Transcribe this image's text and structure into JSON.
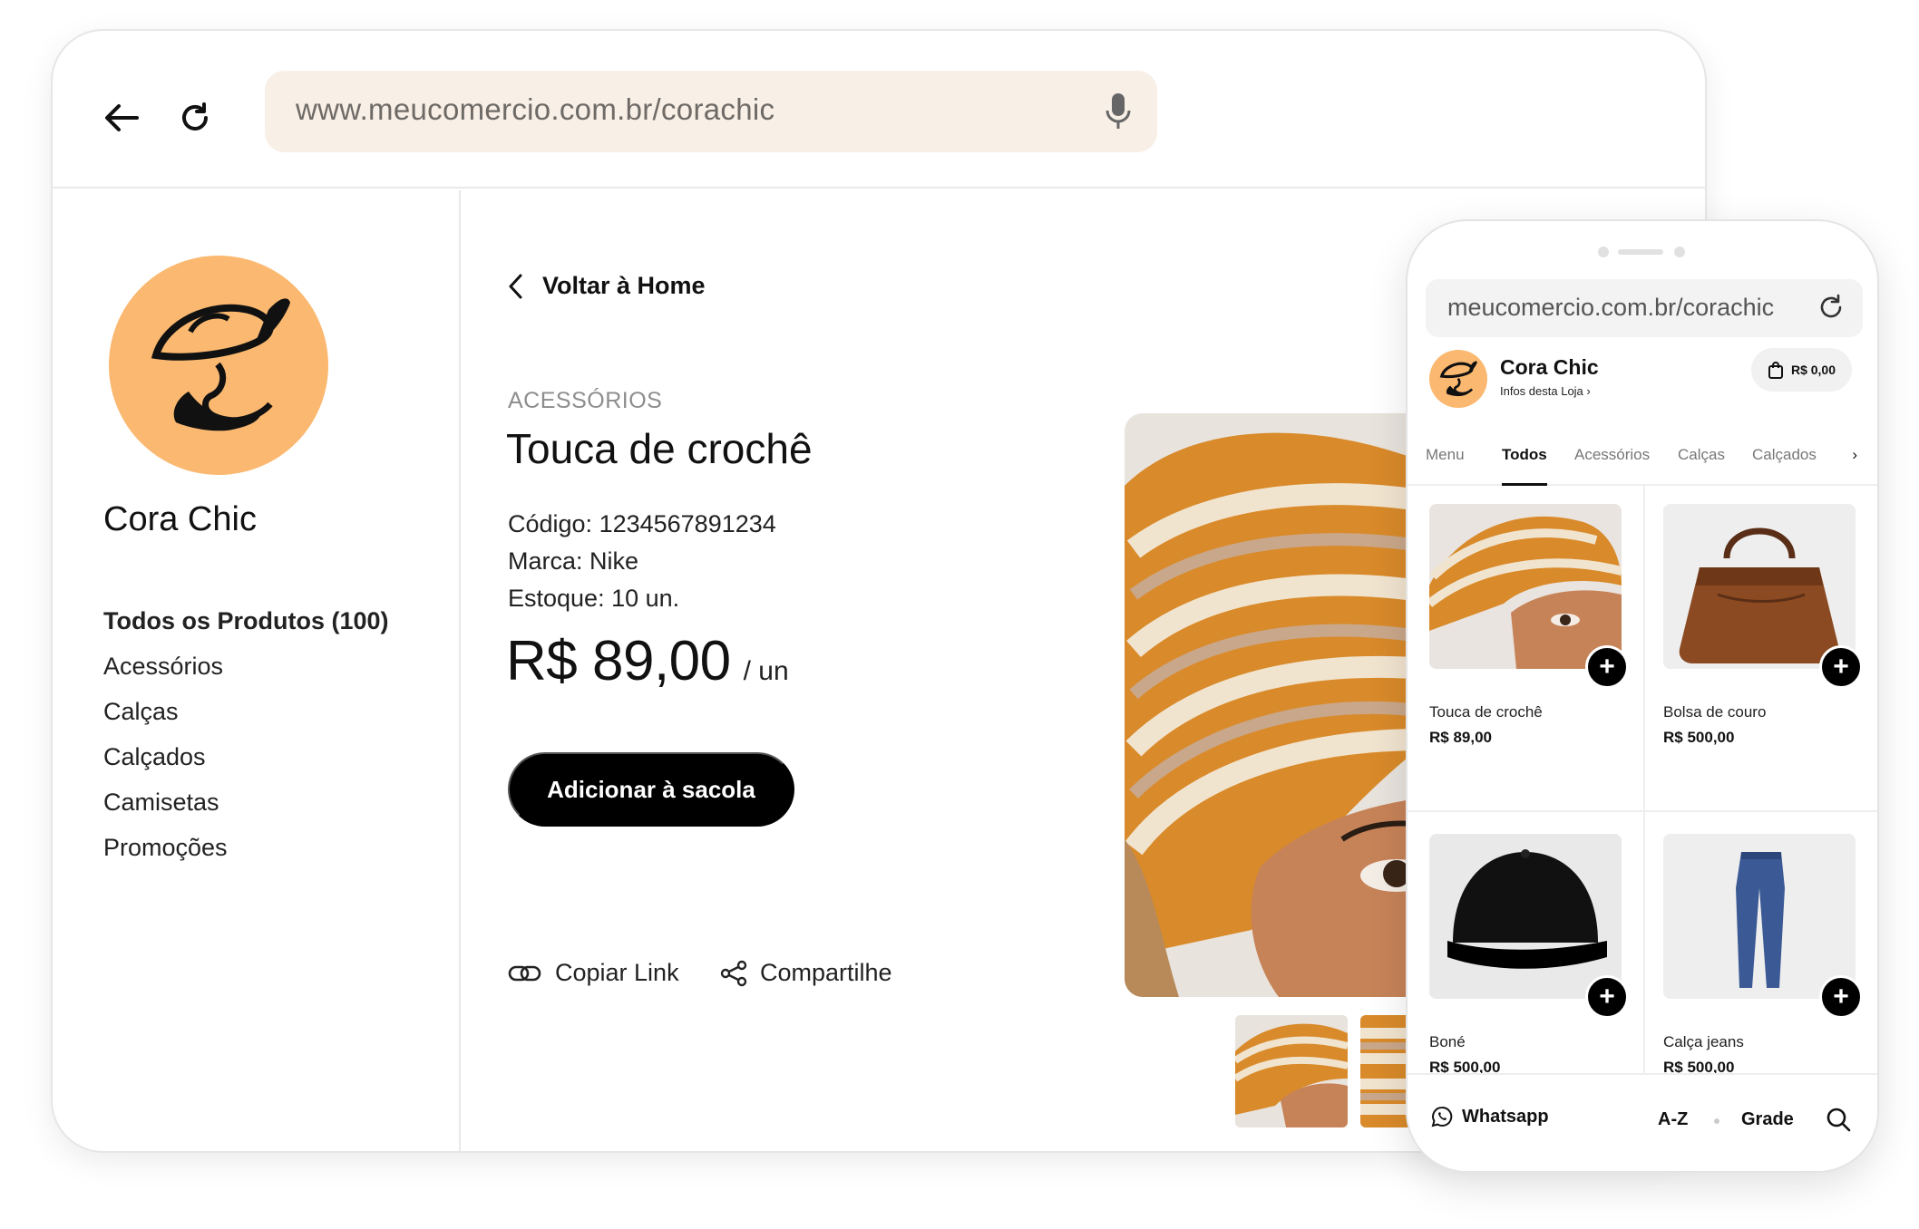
{
  "desktop": {
    "url": "www.meucomercio.com.br/corachic",
    "store_name": "Cora Chic",
    "categories": [
      "Todos os Produtos (100)",
      "Acessórios",
      "Calças",
      "Calçados",
      "Camisetas",
      "Promoções"
    ],
    "back_label": "Voltar à Home",
    "product": {
      "category": "ACESSÓRIOS",
      "title": "Touca de crochê",
      "code": "Código: 1234567891234",
      "brand": "Marca: Nike",
      "stock": "Estoque: 10 un.",
      "price": "R$ 89,00",
      "unit": "/ un",
      "add_button": "Adicionar à sacola",
      "copy_link": "Copiar Link",
      "share": "Compartilhe"
    }
  },
  "mobile": {
    "url": "meucomercio.com.br/corachic",
    "store_name": "Cora Chic",
    "store_info": "Infos desta Loja",
    "cart_total": "R$ 0,00",
    "tabs": [
      "Menu",
      "Todos",
      "Acessórios",
      "Calças",
      "Calçados"
    ],
    "active_tab": "Todos",
    "products": [
      {
        "name": "Touca de crochê",
        "price": "R$ 89,00"
      },
      {
        "name": "Bolsa de couro",
        "price": "R$ 500,00"
      },
      {
        "name": "Boné",
        "price": "R$ 500,00"
      },
      {
        "name": "Calça jeans",
        "price": "R$ 500,00"
      }
    ],
    "bottom": {
      "whatsapp": "Whatsapp",
      "sort": "A-Z",
      "view": "Grade"
    }
  },
  "colors": {
    "brand_orange": "#fbb870",
    "url_bg": "#f8efe6",
    "button_black": "#000000"
  }
}
